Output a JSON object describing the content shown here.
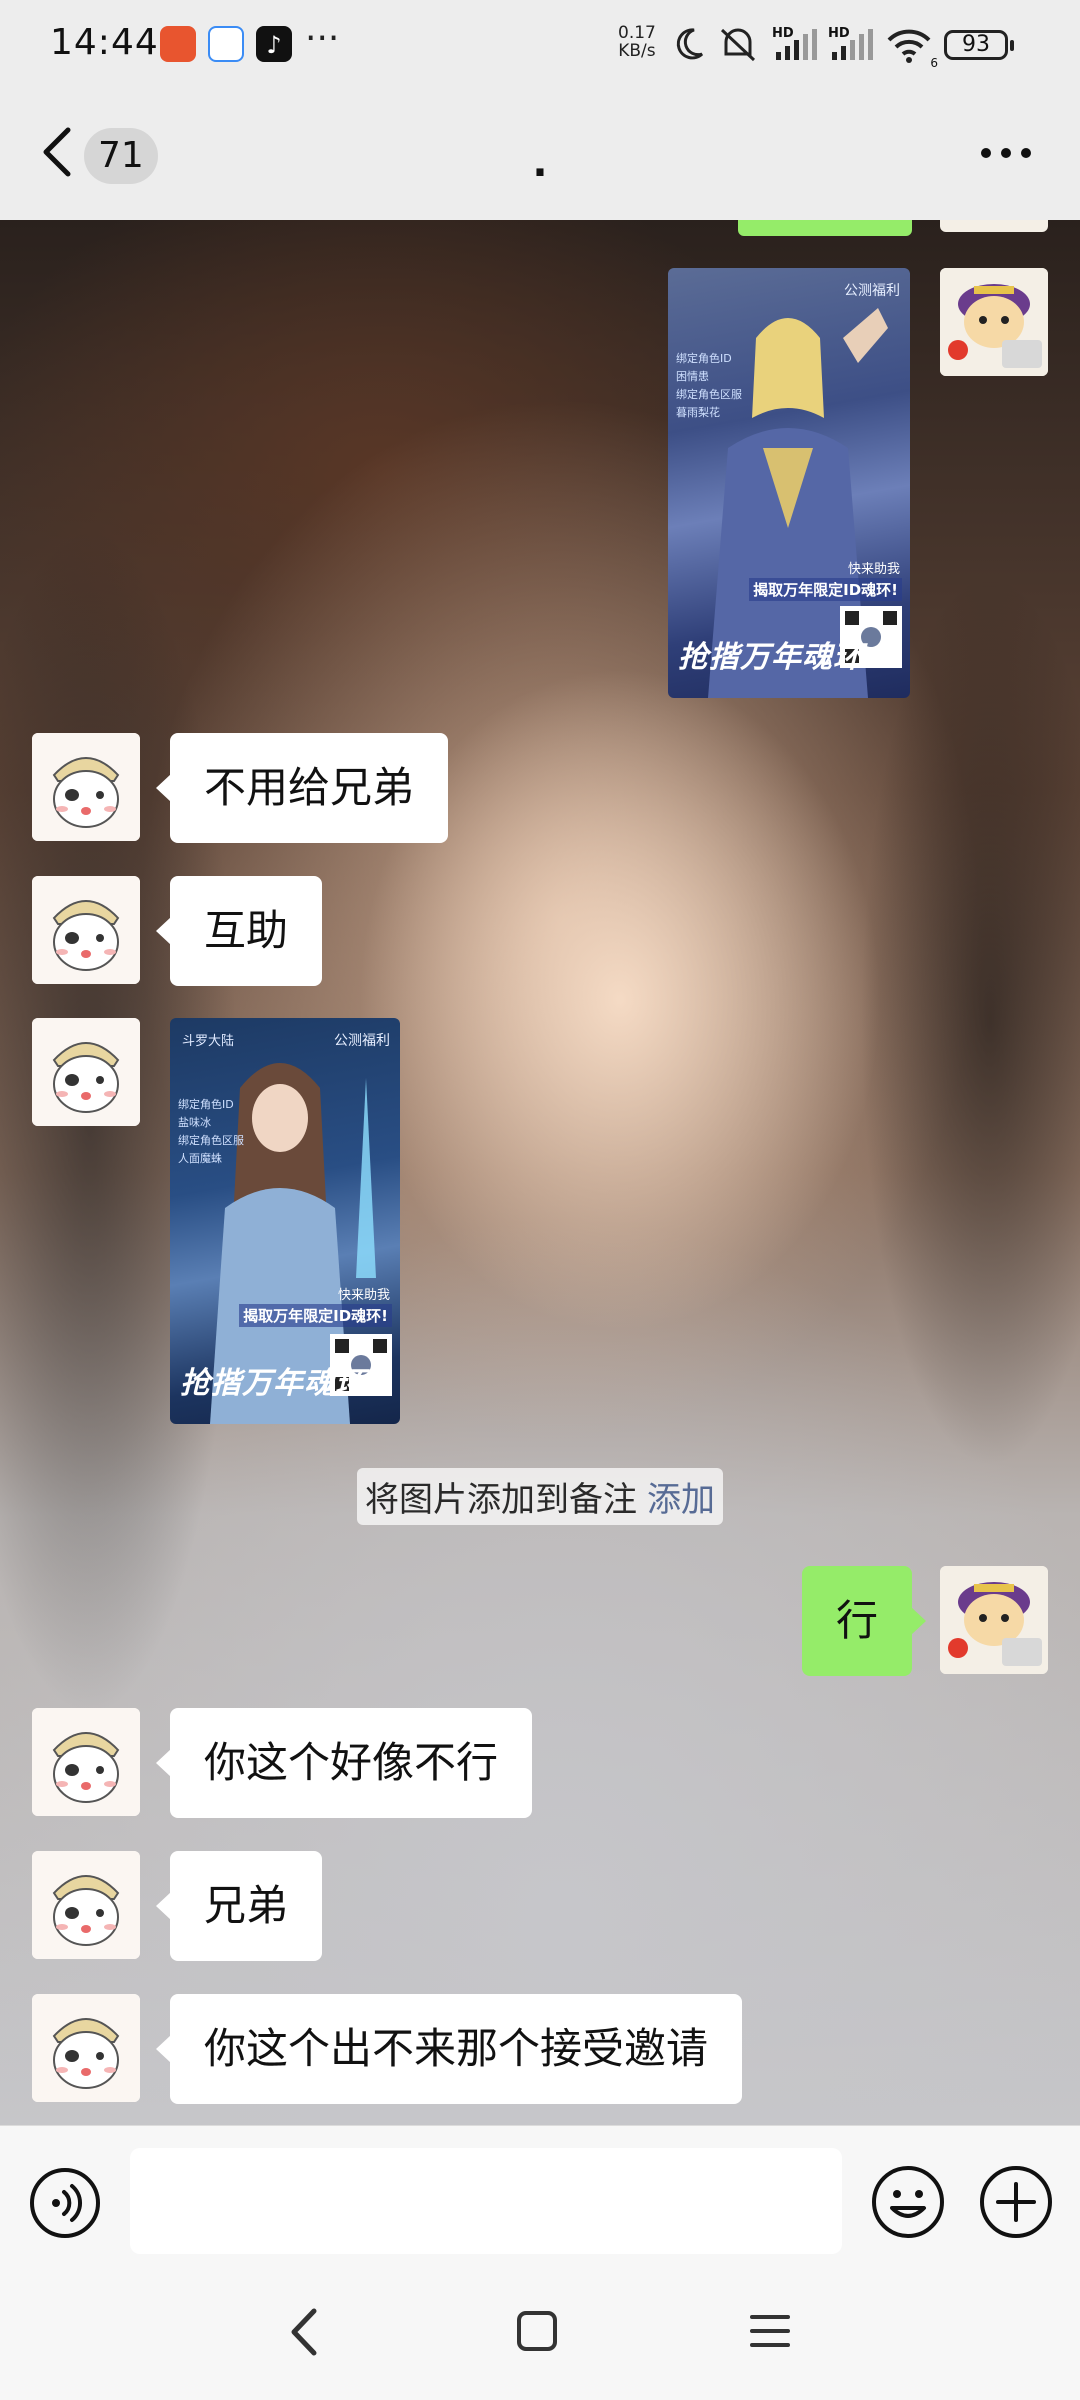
{
  "status_bar": {
    "time": "14:44",
    "overflow": "···",
    "net_speed_value": "0.17",
    "net_speed_unit": "KB/s",
    "sim1": "HD",
    "sim2": "HD",
    "wifi_index": "6",
    "battery": "93",
    "icons": [
      "app-icon-orange",
      "app-icon-chat",
      "tiktok-icon",
      "moon-icon",
      "mute-icon",
      "signal-icon",
      "signal-icon",
      "wifi-icon",
      "battery-icon"
    ]
  },
  "header": {
    "unread_count": "71",
    "title": ".",
    "icons": [
      "back-chevron-icon",
      "more-dots-icon"
    ]
  },
  "messages": [
    {
      "side": "right",
      "type": "image",
      "poster_side_text": [
        "绑定角色ID",
        "困情患",
        "绑定角色区服",
        "暮雨梨花"
      ],
      "poster_help": "快来助我",
      "poster_limit": "揭取万年限定ID魂环!",
      "poster_title": "抢揩万年魂环"
    },
    {
      "side": "left",
      "type": "text",
      "text": "不用给兄弟"
    },
    {
      "side": "left",
      "type": "text",
      "text": "互助"
    },
    {
      "side": "left",
      "type": "image",
      "poster_side_text": [
        "绑定角色ID",
        "盐味冰",
        "绑定角色区服",
        "人面魔蛛"
      ],
      "poster_help": "快来助我",
      "poster_limit": "揭取万年限定ID魂环!",
      "poster_title": "抢揩万年魂环"
    },
    {
      "side": "right",
      "type": "text",
      "text": "行"
    },
    {
      "side": "left",
      "type": "text",
      "text": "你这个好像不行"
    },
    {
      "side": "left",
      "type": "text",
      "text": "兄弟"
    },
    {
      "side": "left",
      "type": "text",
      "text": "你这个出不来那个接受邀请"
    }
  ],
  "system_tip": {
    "text": "将图片添加到备注",
    "action": "添加"
  },
  "input_bar": {
    "value": "",
    "icons": [
      "voice-icon",
      "emoji-icon",
      "plus-icon"
    ]
  },
  "nav_bar": {
    "icons": [
      "nav-back-icon",
      "nav-home-icon",
      "nav-menu-icon"
    ]
  },
  "colors": {
    "self_bubble": "#95ec69",
    "other_bubble": "#ffffff",
    "link": "#576b95",
    "bar_bg": "#ededed"
  }
}
